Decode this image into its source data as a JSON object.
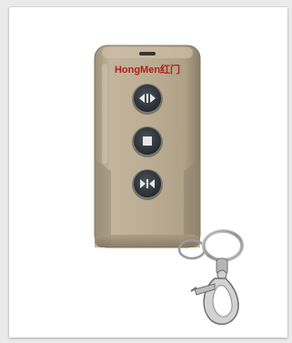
{
  "photo": {
    "subject": "remote-control-key-fob"
  },
  "remote": {
    "brand_label": "HongMen红门",
    "buttons": [
      {
        "icon": "open-close-icon"
      },
      {
        "icon": "stop-icon"
      },
      {
        "icon": "close-open-icon"
      }
    ]
  },
  "colors": {
    "body": "#b5a790",
    "body_shadow": "#8f826d",
    "brand_red": "#b0201c",
    "button": "#2c3238",
    "background": "#ffffff"
  }
}
